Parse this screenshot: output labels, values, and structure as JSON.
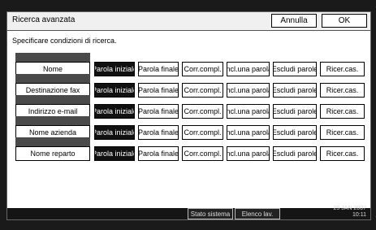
{
  "window": {
    "title": "Ricerca avanzata",
    "cancel_label": "Annulla",
    "ok_label": "OK"
  },
  "instruction": "Specificare condizioni di ricerca.",
  "fields": [
    {
      "label": "Nome"
    },
    {
      "label": "Destinazione fax"
    },
    {
      "label": "Indirizzo e-mail"
    },
    {
      "label": "Nome azienda"
    },
    {
      "label": "Nome reparto"
    }
  ],
  "options": [
    "Parola iniziale",
    "Parola finale",
    "Corr.compl.",
    "Incl.una parola",
    "Escludi parole",
    "Ricer.cas."
  ],
  "selected_option": "Parola iniziale",
  "statusbar": {
    "system_status": "Stato sistema",
    "job_list": "Elenco lav.",
    "date": "25 JAN 2007",
    "time": "10:11"
  }
}
